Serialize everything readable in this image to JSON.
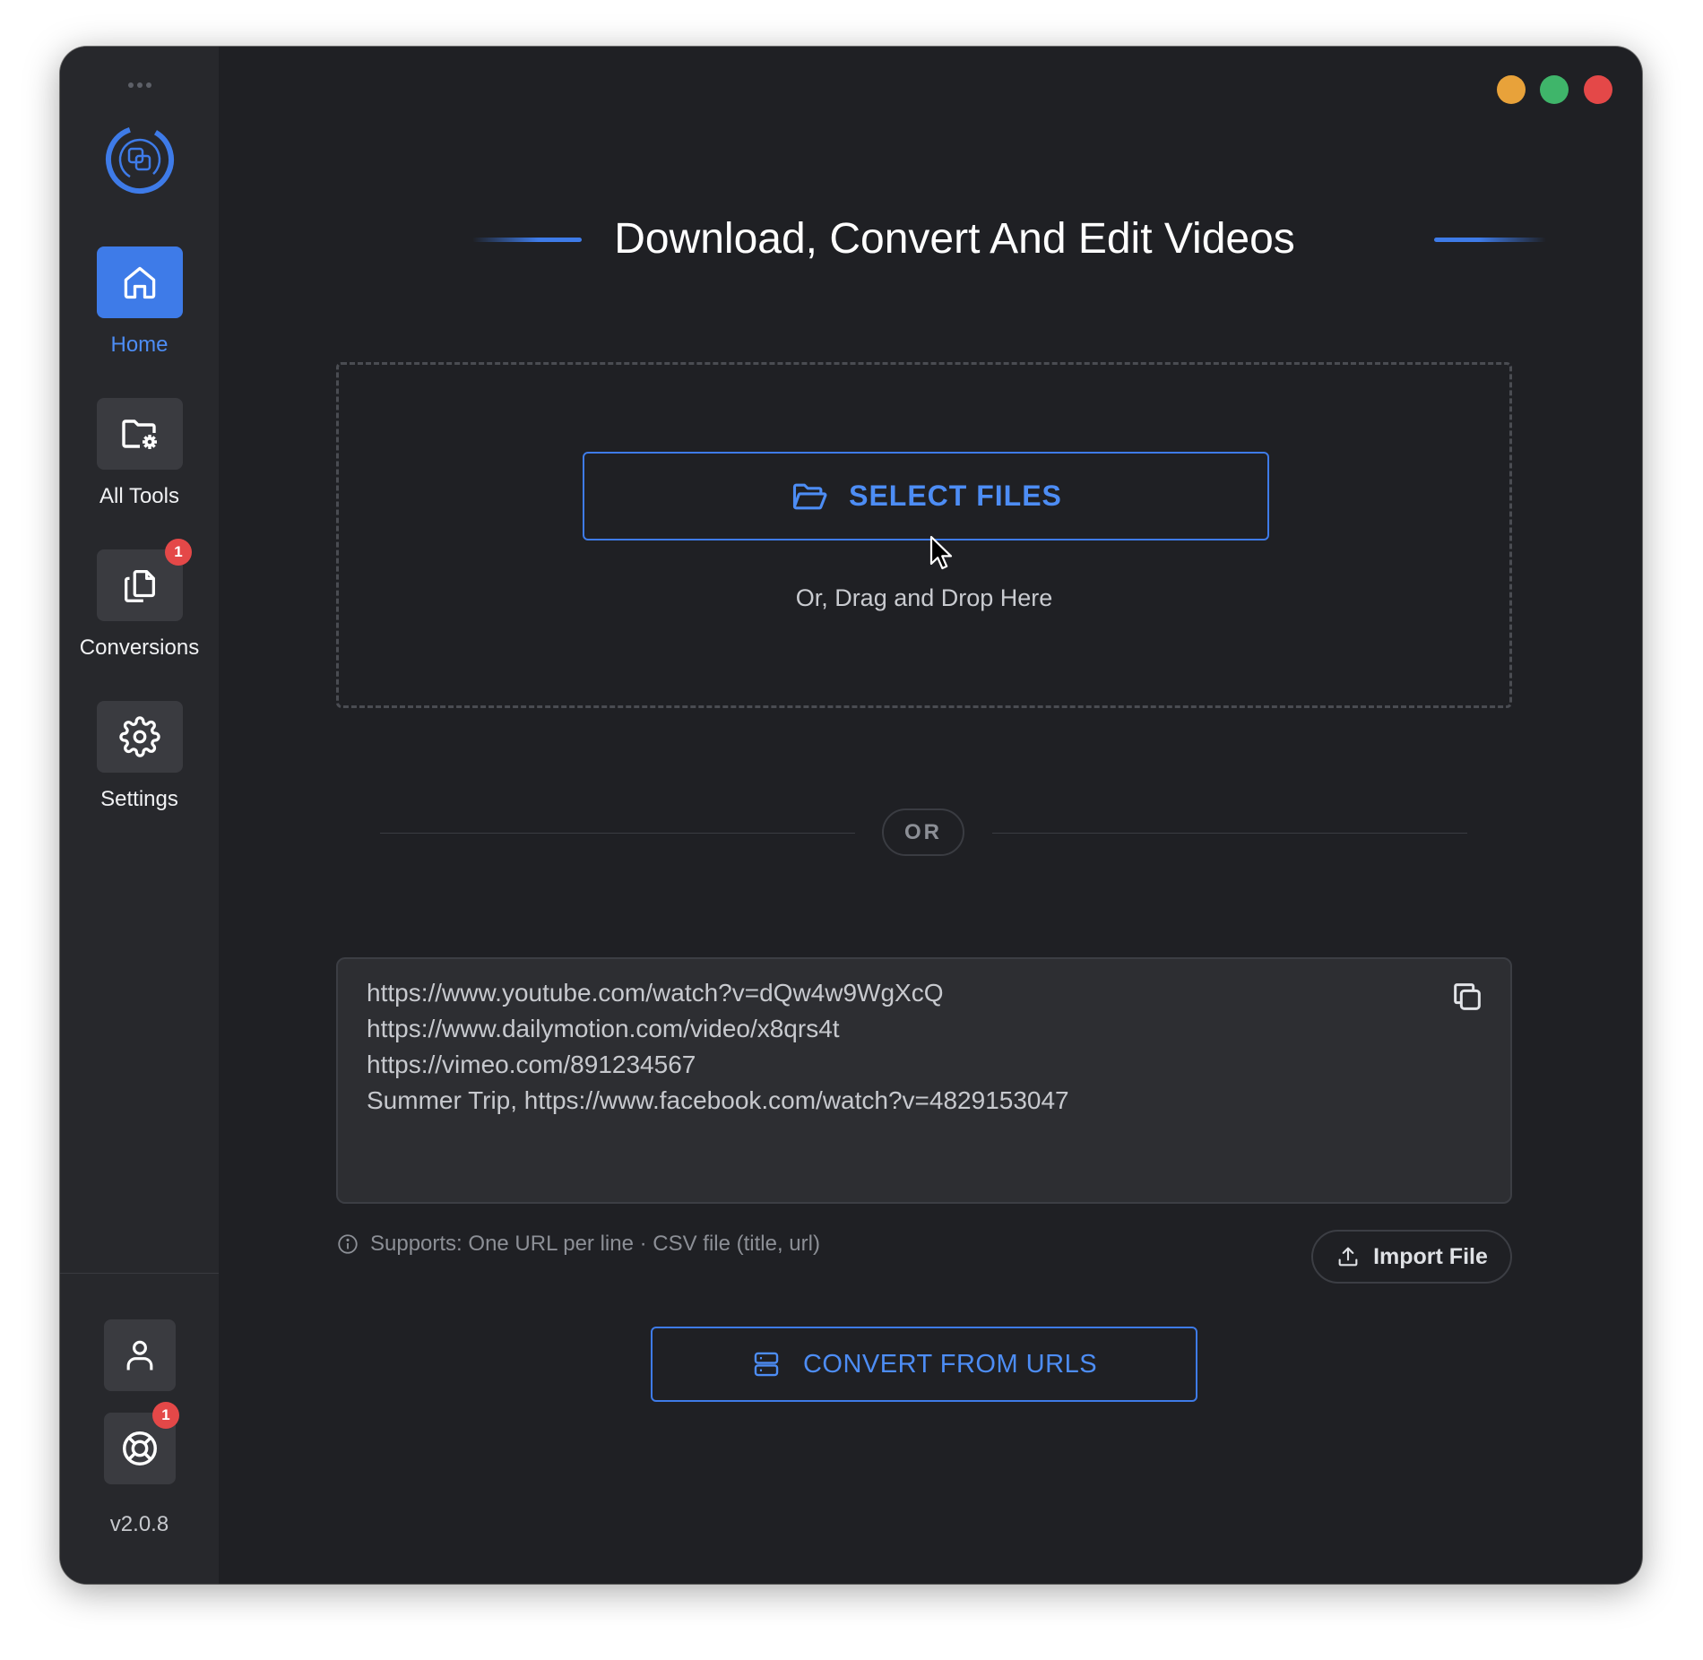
{
  "window": {
    "title": "Download, Convert And Edit Videos",
    "traffic_lights": {
      "minimize": "#e8a23a",
      "zoom": "#3fb56a",
      "close": "#e44848"
    }
  },
  "colors": {
    "accent": "#3e7be8",
    "sidebar": "#27282c",
    "background": "#1f2024"
  },
  "sidebar": {
    "items": [
      {
        "label": "Home",
        "icon": "home-icon",
        "active": true
      },
      {
        "label": "All Tools",
        "icon": "folder-gear-icon",
        "active": false
      },
      {
        "label": "Conversions",
        "icon": "copy-files-icon",
        "active": false,
        "badge": "1"
      },
      {
        "label": "Settings",
        "icon": "gear-icon",
        "active": false
      }
    ],
    "account_icon": "user-icon",
    "help": {
      "icon": "lifebuoy-icon",
      "badge": "1"
    },
    "version": "v2.0.8"
  },
  "dropzone": {
    "select_label": "SELECT FILES",
    "drag_text": "Or, Drag and Drop Here"
  },
  "divider": {
    "label": "OR"
  },
  "urls": {
    "lines": [
      "https://www.youtube.com/watch?v=dQw4w9WgXcQ",
      "https://www.dailymotion.com/video/x8qrs4t",
      "https://vimeo.com/891234567",
      "Summer Trip, https://www.facebook.com/watch?v=4829153047"
    ],
    "support_text": "Supports: One URL per line · CSV file (title, url)",
    "import_label": "Import File",
    "convert_label": "CONVERT FROM URLS"
  }
}
